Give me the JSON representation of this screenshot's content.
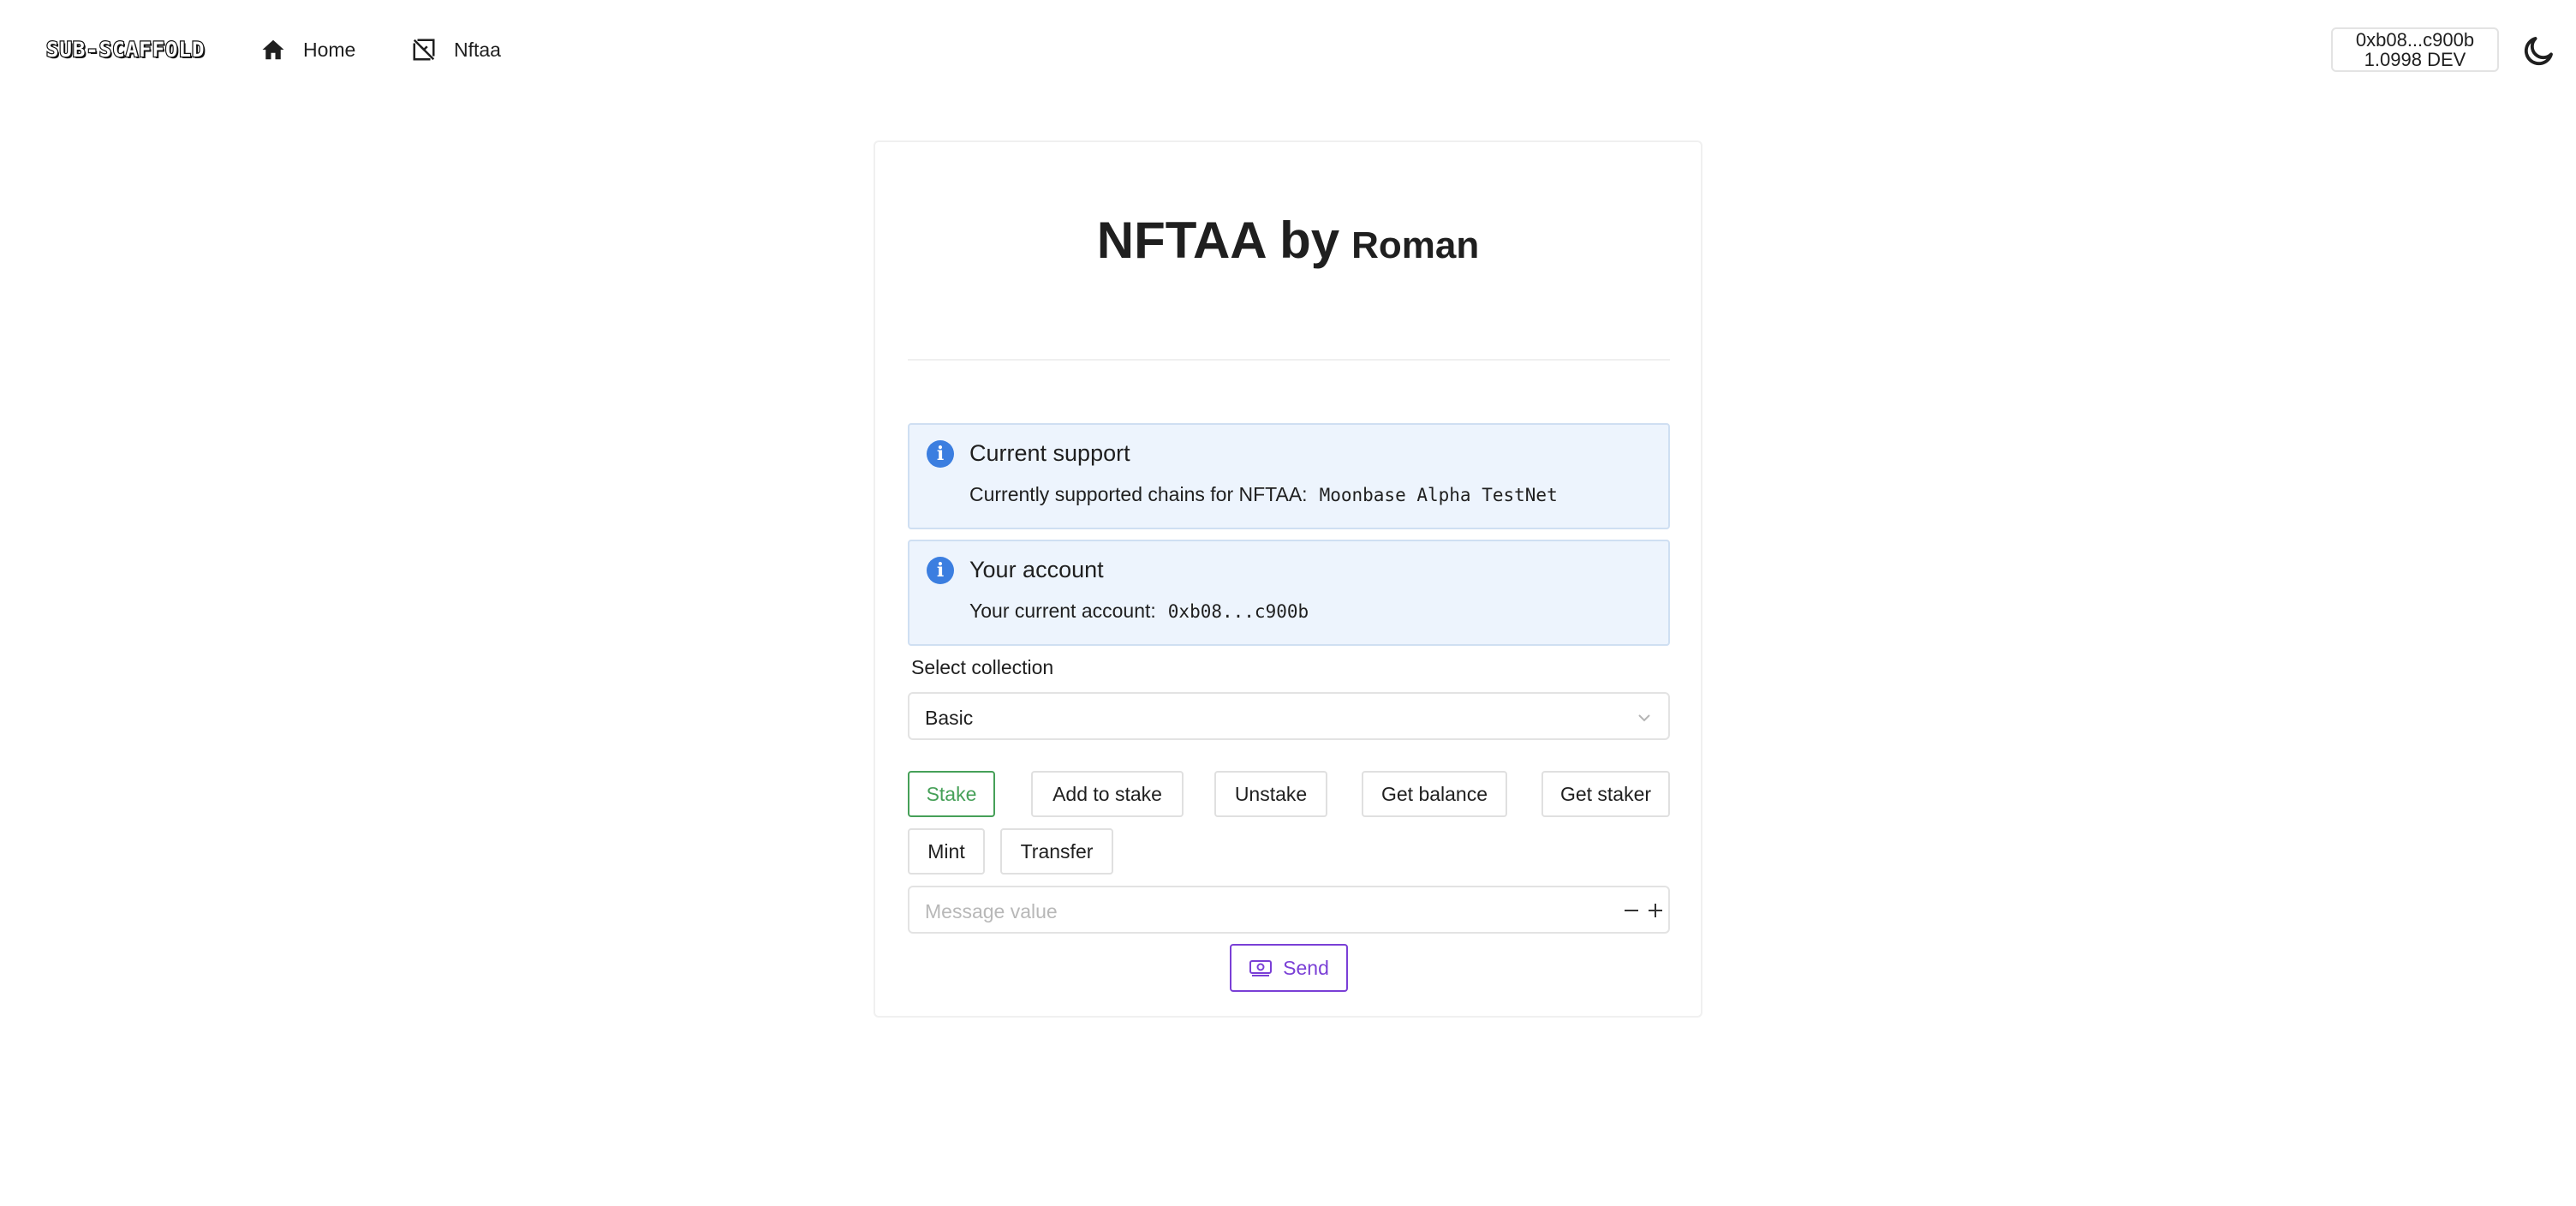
{
  "navbar": {
    "logo_text": "SUB-SCAFFOLD",
    "links": [
      {
        "label": "Home",
        "icon": "home-icon"
      },
      {
        "label": "Nftaa",
        "icon": "nft-icon"
      }
    ],
    "account": {
      "address": "0xb08...c900b",
      "balance": "1.0998 DEV"
    },
    "theme_icon": "moon-icon"
  },
  "card": {
    "title": "NFTAA by",
    "title_author": "Roman",
    "alerts": [
      {
        "title": "Current support",
        "text": "Currently supported chains for NFTAA:",
        "value": "Moonbase Alpha TestNet",
        "icon": "info-icon"
      },
      {
        "title": "Your account",
        "text": "Your current account:",
        "value": "0xb08...c900b",
        "icon": "info-icon"
      }
    ],
    "select": {
      "label": "Select collection",
      "value": "Basic"
    },
    "actions": [
      {
        "label": "Stake",
        "active": true
      },
      {
        "label": "Add to stake",
        "active": false
      },
      {
        "label": "Unstake",
        "active": false
      },
      {
        "label": "Get balance",
        "active": false
      },
      {
        "label": "Get staker",
        "active": false
      },
      {
        "label": "Mint",
        "active": false
      },
      {
        "label": "Transfer",
        "active": false
      }
    ],
    "message_input": {
      "placeholder": "Message value",
      "value": ""
    },
    "send_label": "Send"
  },
  "colors": {
    "accent_active": "#46a058",
    "send_purple": "#7a3fd6",
    "info_blue": "#3b7ee0",
    "alert_bg": "#edf4fd"
  }
}
